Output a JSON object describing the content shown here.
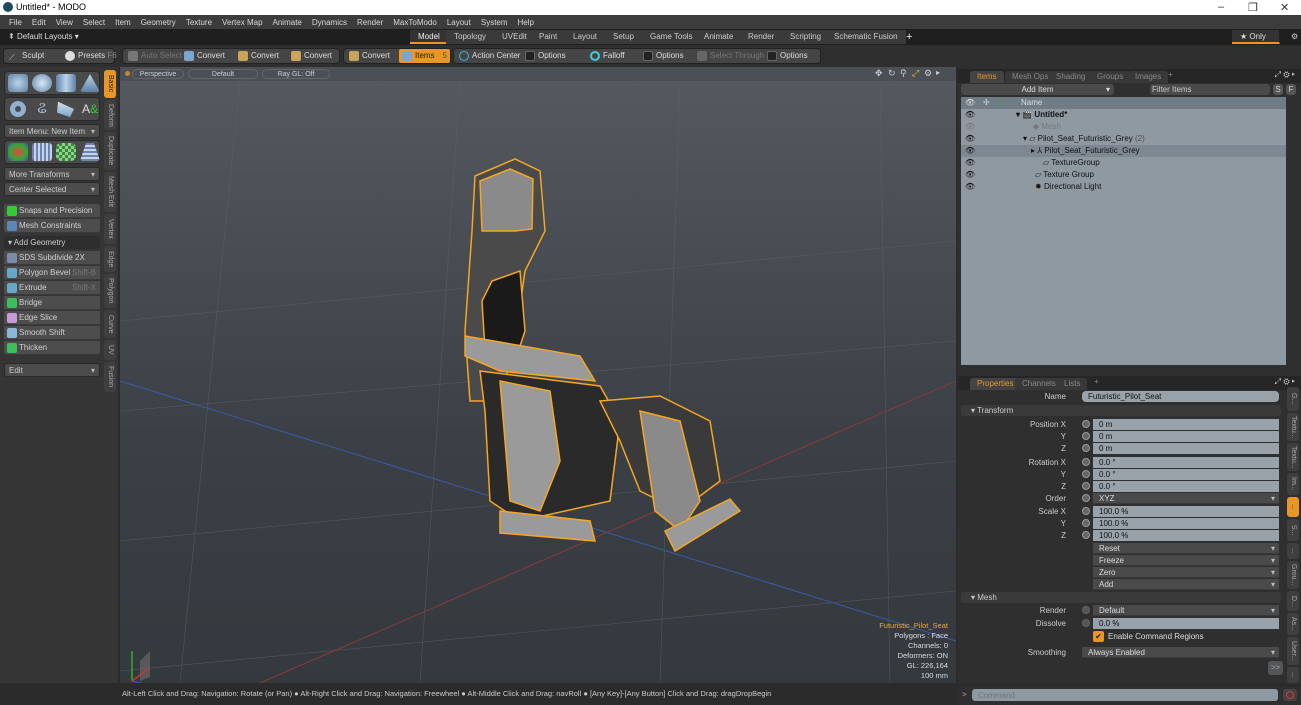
{
  "window": {
    "title": "Untitled* - MODO",
    "min": "–",
    "max": "❐",
    "close": "✕"
  },
  "menu": [
    "File",
    "Edit",
    "View",
    "Select",
    "Item",
    "Geometry",
    "Texture",
    "Vertex Map",
    "Animate",
    "Dynamics",
    "Render",
    "MaxToModo",
    "Layout",
    "System",
    "Help"
  ],
  "layouts": {
    "selector": "Default Layouts ▾",
    "tabs": [
      "Model",
      "Topology",
      "UVEdit",
      "Paint",
      "Layout",
      "Setup",
      "Game Tools",
      "Animate",
      "Render",
      "Scripting",
      "Schematic Fusion"
    ],
    "active": "Model",
    "add": "+",
    "only": "★ Only",
    "gear": "⚙"
  },
  "toolbar": {
    "sculpt": "Sculpt",
    "presets": "Presets",
    "presets_key": "F6",
    "auto_select": "Auto Select",
    "convert1": "Convert",
    "convert2": "Convert",
    "convert3": "Convert",
    "convert4": "Convert",
    "items": "Items",
    "items_count": "5",
    "action_center": "Action Center",
    "options1": "Options",
    "falloff": "Falloff",
    "options2": "Options",
    "select_through": "Select Through",
    "options3": "Options"
  },
  "left_panel": {
    "item_menu": "Item Menu: New Item",
    "more_transforms": "More Transforms",
    "center_selected": "Center Selected",
    "snaps": "Snaps and Precision",
    "mesh_constraints": "Mesh Constraints",
    "add_geometry": "▾ Add Geometry",
    "tools": [
      {
        "label": "SDS Subdivide 2X",
        "shortcut": ""
      },
      {
        "label": "Polygon Bevel",
        "shortcut": "Shift-B"
      },
      {
        "label": "Extrude",
        "shortcut": "Shift-X"
      },
      {
        "label": "Bridge",
        "shortcut": ""
      },
      {
        "label": "Edge Slice",
        "shortcut": ""
      },
      {
        "label": "Smooth Shift",
        "shortcut": ""
      },
      {
        "label": "Thicken",
        "shortcut": ""
      }
    ],
    "edit": "Edit",
    "vtabs": [
      "Basic",
      "Deform",
      "Duplicate",
      "Mesh Edit",
      "Vertex",
      "Edge",
      "Polygon",
      "Curve",
      "UV",
      "Fusion"
    ]
  },
  "viewport": {
    "view": "Perspective",
    "style": "Default",
    "raygl": "Ray GL: Off",
    "info": {
      "name": "Futuristic_Pilot_Seat",
      "polygons": "Polygons : Face",
      "channels": "Channels: 0",
      "deformers": "Deformers: ON",
      "gl": "GL: 226,164",
      "unit": "100 mm"
    }
  },
  "items_panel": {
    "tabs": [
      "Items",
      "Mesh Ops",
      "Shading",
      "Groups",
      "Images"
    ],
    "add_item": "Add Item",
    "filter": "Filter Items",
    "s": "S",
    "f": "F",
    "col_name": "Name",
    "rows": [
      {
        "name": "Untitled*",
        "extra": ""
      },
      {
        "name": "Mesh",
        "extra": ""
      },
      {
        "name": "Pilot_Seat_Futuristic_Grey",
        "extra": "(2)"
      },
      {
        "name": "Pilot_Seat_Futuristic_Grey",
        "extra": ""
      },
      {
        "name": "TextureGroup",
        "extra": ""
      },
      {
        "name": "Texture Group",
        "extra": ""
      },
      {
        "name": "Directional Light",
        "extra": ""
      }
    ]
  },
  "properties": {
    "tabs": [
      "Properties",
      "Channels",
      "Lists"
    ],
    "name_label": "Name",
    "name_value": "Futuristic_Pilot_Seat",
    "transform": "Transform",
    "position": [
      {
        "l": "Position X",
        "v": "0 m"
      },
      {
        "l": "Y",
        "v": "0 m"
      },
      {
        "l": "Z",
        "v": "0 m"
      }
    ],
    "rotation": [
      {
        "l": "Rotation X",
        "v": "0.0 °"
      },
      {
        "l": "Y",
        "v": "0.0 °"
      },
      {
        "l": "Z",
        "v": "0.0 °"
      }
    ],
    "order_label": "Order",
    "order_value": "XYZ",
    "scale": [
      {
        "l": "Scale X",
        "v": "100.0 %"
      },
      {
        "l": "Y",
        "v": "100.0 %"
      },
      {
        "l": "Z",
        "v": "100.0 %"
      }
    ],
    "actions": [
      "Reset",
      "Freeze",
      "Zero",
      "Add"
    ],
    "mesh": "Mesh",
    "render_label": "Render",
    "render_value": "Default",
    "dissolve_label": "Dissolve",
    "dissolve_value": "0.0 %",
    "command_regions": "Enable Command Regions",
    "smoothing_label": "Smoothing",
    "smoothing_value": "Always Enabled",
    "more": ">>",
    "vtabs": [
      "G...",
      "Textu...",
      "Textu...",
      "Im...",
      "...",
      "S...",
      "...",
      "Grou...",
      "D...",
      "As...",
      "User...",
      "..."
    ]
  },
  "statusbar": "Alt-Left Click and Drag: Navigation: Rotate (or Pan) ● Alt-Right Click and Drag: Navigation: Freewheel ● Alt-Middle Click and Drag: navRoll ● [Any Key]-[Any Button] Click and Drag: dragDropBegin",
  "command": {
    "prompt": ">",
    "placeholder": "Command"
  }
}
